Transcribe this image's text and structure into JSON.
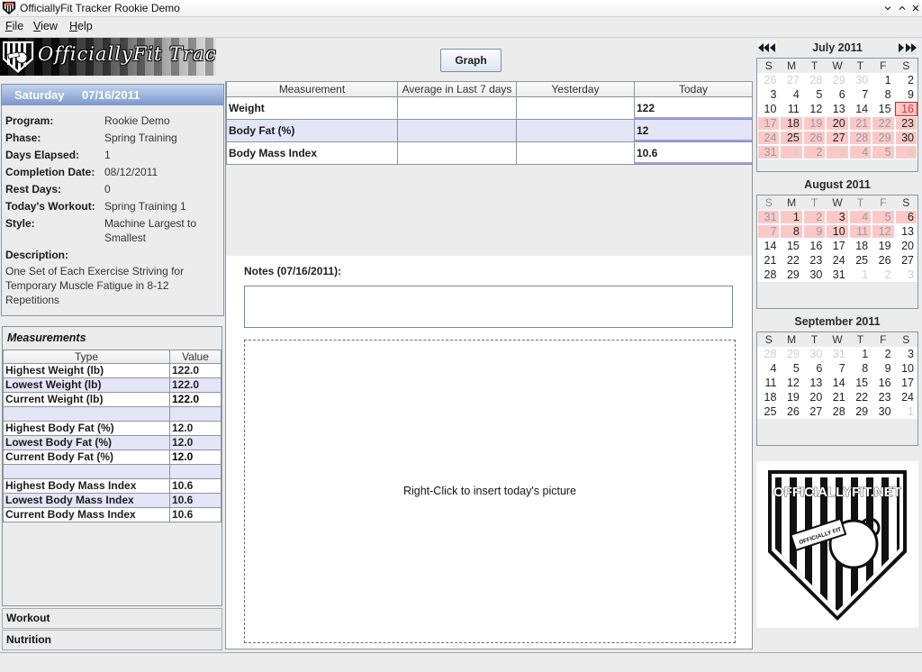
{
  "window": {
    "title": "OfficiallyFit Tracker Rookie Demo",
    "controls": [
      "minimize",
      "maximize",
      "close"
    ]
  },
  "menu": {
    "items": [
      {
        "label": "File"
      },
      {
        "label": "View"
      },
      {
        "label": "Help"
      }
    ]
  },
  "banner": {
    "text": "OfficiallyFit Tracker"
  },
  "day_header": {
    "weekday": "Saturday",
    "date": "07/16/2011"
  },
  "program_info": {
    "rows": [
      {
        "label": "Program:",
        "value": "Rookie Demo"
      },
      {
        "label": "Phase:",
        "value": "Spring Training"
      },
      {
        "label": "Days Elapsed:",
        "value": "1"
      },
      {
        "label": "Completion Date:",
        "value": "08/12/2011"
      },
      {
        "label": "Rest Days:",
        "value": "0"
      },
      {
        "label": "Today's Workout:",
        "value": "Spring Training 1"
      },
      {
        "label": "Style:",
        "value": "Machine Largest to Smallest"
      }
    ],
    "description_label": "Description:",
    "description": "One Set of Each Exercise Striving for Temporary Muscle Fatigue in 8-12 Repetitions"
  },
  "measurements": {
    "title": "Measurements",
    "columns": [
      "Type",
      "Value"
    ],
    "rows": [
      {
        "type": "Highest Weight (lb)",
        "value": "122.0"
      },
      {
        "type": "Lowest Weight (lb)",
        "value": "122.0"
      },
      {
        "type": "Current Weight (lb)",
        "value": "122.0"
      },
      {
        "type": "",
        "value": ""
      },
      {
        "type": "Highest Body Fat (%)",
        "value": "12.0"
      },
      {
        "type": "Lowest Body Fat (%)",
        "value": "12.0"
      },
      {
        "type": "Current Body Fat (%)",
        "value": "12.0"
      },
      {
        "type": "",
        "value": ""
      },
      {
        "type": "Highest Body Mass Index",
        "value": "10.6"
      },
      {
        "type": "Lowest Body Mass Index",
        "value": "10.6"
      },
      {
        "type": "Current Body Mass Index",
        "value": "10.6"
      }
    ]
  },
  "side_nav": {
    "workout": "Workout",
    "nutrition": "Nutrition"
  },
  "toolbar": {
    "graph_label": "Graph"
  },
  "daily_table": {
    "columns": [
      "Measurement",
      "Average in Last 7 days",
      "Yesterday",
      "Today"
    ],
    "rows": [
      {
        "measurement": "Weight",
        "average": "",
        "yesterday": "",
        "today": "122"
      },
      {
        "measurement": "Body Fat (%)",
        "average": "",
        "yesterday": "",
        "today": "12"
      },
      {
        "measurement": "Body Mass Index",
        "average": "",
        "yesterday": "",
        "today": "10.6"
      }
    ]
  },
  "notes": {
    "label": "Notes (07/16/2011):",
    "value": ""
  },
  "picture": {
    "hint": "Right-Click to insert today's picture"
  },
  "calendars": [
    {
      "title": "July 2011",
      "dow": [
        {
          "l": "S"
        },
        {
          "l": "M"
        },
        {
          "l": "T"
        },
        {
          "l": "W"
        },
        {
          "l": "T"
        },
        {
          "l": "F"
        },
        {
          "l": "S"
        }
      ],
      "weeks": [
        [
          {
            "d": "26",
            "tone": "faint"
          },
          {
            "d": "27",
            "tone": "faint"
          },
          {
            "d": "28",
            "tone": "faint"
          },
          {
            "d": "29",
            "tone": "faint"
          },
          {
            "d": "30",
            "tone": "faint"
          },
          {
            "d": "1"
          },
          {
            "d": "2"
          }
        ],
        [
          {
            "d": "3"
          },
          {
            "d": "4"
          },
          {
            "d": "5"
          },
          {
            "d": "6"
          },
          {
            "d": "7"
          },
          {
            "d": "8"
          },
          {
            "d": "9"
          }
        ],
        [
          {
            "d": "10"
          },
          {
            "d": "11"
          },
          {
            "d": "12"
          },
          {
            "d": "13"
          },
          {
            "d": "14"
          },
          {
            "d": "15"
          },
          {
            "d": "16",
            "sched": true,
            "today": true
          }
        ],
        [
          {
            "d": "17",
            "tone": "muted",
            "sched": true
          },
          {
            "d": "18",
            "sched": true
          },
          {
            "d": "19",
            "tone": "muted",
            "sched": true
          },
          {
            "d": "20",
            "sched": true
          },
          {
            "d": "21",
            "tone": "muted",
            "sched": true
          },
          {
            "d": "22",
            "tone": "muted",
            "sched": true
          },
          {
            "d": "23",
            "sched": true
          }
        ],
        [
          {
            "d": "24",
            "tone": "muted",
            "sched": true
          },
          {
            "d": "25",
            "sched": true
          },
          {
            "d": "26",
            "tone": "muted",
            "sched": true
          },
          {
            "d": "27",
            "sched": true
          },
          {
            "d": "28",
            "tone": "muted",
            "sched": true
          },
          {
            "d": "29",
            "tone": "muted",
            "sched": true
          },
          {
            "d": "30",
            "sched": true
          }
        ],
        [
          {
            "d": "31",
            "tone": "muted",
            "sched": true
          },
          {
            "d": "1",
            "tone": "faint",
            "sched": true
          },
          {
            "d": "2",
            "tone": "muted",
            "sched": true
          },
          {
            "d": "3",
            "tone": "faint",
            "sched": true
          },
          {
            "d": "4",
            "tone": "muted",
            "sched": true
          },
          {
            "d": "5",
            "tone": "muted",
            "sched": true
          },
          {
            "d": "6",
            "tone": "faint",
            "sched": true
          }
        ]
      ]
    },
    {
      "title": "August 2011",
      "dow": [
        {
          "l": "S",
          "muted": true
        },
        {
          "l": "M"
        },
        {
          "l": "T",
          "muted": true
        },
        {
          "l": "W"
        },
        {
          "l": "T",
          "muted": true
        },
        {
          "l": "F",
          "muted": true
        },
        {
          "l": "S"
        }
      ],
      "weeks": [
        [
          {
            "d": "31",
            "tone": "muted",
            "sched": true
          },
          {
            "d": "1",
            "sched": true
          },
          {
            "d": "2",
            "tone": "muted",
            "sched": true
          },
          {
            "d": "3",
            "sched": true
          },
          {
            "d": "4",
            "tone": "muted",
            "sched": true
          },
          {
            "d": "5",
            "tone": "muted",
            "sched": true
          },
          {
            "d": "6",
            "sched": true
          }
        ],
        [
          {
            "d": "7",
            "tone": "muted",
            "sched": true
          },
          {
            "d": "8",
            "sched": true
          },
          {
            "d": "9",
            "tone": "muted",
            "sched": true
          },
          {
            "d": "10",
            "sched": true
          },
          {
            "d": "11",
            "tone": "muted",
            "sched": true
          },
          {
            "d": "12",
            "tone": "muted",
            "sched": true
          },
          {
            "d": "13"
          }
        ],
        [
          {
            "d": "14"
          },
          {
            "d": "15"
          },
          {
            "d": "16"
          },
          {
            "d": "17"
          },
          {
            "d": "18"
          },
          {
            "d": "19"
          },
          {
            "d": "20"
          }
        ],
        [
          {
            "d": "21"
          },
          {
            "d": "22"
          },
          {
            "d": "23"
          },
          {
            "d": "24"
          },
          {
            "d": "25"
          },
          {
            "d": "26"
          },
          {
            "d": "27"
          }
        ],
        [
          {
            "d": "28"
          },
          {
            "d": "29"
          },
          {
            "d": "30"
          },
          {
            "d": "31"
          },
          {
            "d": "1",
            "tone": "faint"
          },
          {
            "d": "2",
            "tone": "faint"
          },
          {
            "d": "3",
            "tone": "faint"
          }
        ]
      ]
    },
    {
      "title": "September 2011",
      "dow": [
        {
          "l": "S"
        },
        {
          "l": "M"
        },
        {
          "l": "T"
        },
        {
          "l": "W"
        },
        {
          "l": "T"
        },
        {
          "l": "F"
        },
        {
          "l": "S"
        }
      ],
      "weeks": [
        [
          {
            "d": "28",
            "tone": "faint"
          },
          {
            "d": "29",
            "tone": "faint"
          },
          {
            "d": "30",
            "tone": "faint"
          },
          {
            "d": "31",
            "tone": "faint"
          },
          {
            "d": "1"
          },
          {
            "d": "2"
          },
          {
            "d": "3"
          }
        ],
        [
          {
            "d": "4"
          },
          {
            "d": "5"
          },
          {
            "d": "6"
          },
          {
            "d": "7"
          },
          {
            "d": "8"
          },
          {
            "d": "9"
          },
          {
            "d": "10"
          }
        ],
        [
          {
            "d": "11"
          },
          {
            "d": "12"
          },
          {
            "d": "13"
          },
          {
            "d": "14"
          },
          {
            "d": "15"
          },
          {
            "d": "16"
          },
          {
            "d": "17"
          }
        ],
        [
          {
            "d": "18"
          },
          {
            "d": "19"
          },
          {
            "d": "20"
          },
          {
            "d": "21"
          },
          {
            "d": "22"
          },
          {
            "d": "23"
          },
          {
            "d": "24"
          }
        ],
        [
          {
            "d": "25"
          },
          {
            "d": "26"
          },
          {
            "d": "27"
          },
          {
            "d": "28"
          },
          {
            "d": "29"
          },
          {
            "d": "30"
          },
          {
            "d": "1",
            "tone": "faint"
          }
        ]
      ]
    }
  ],
  "logo": {
    "text": "OFFICIALLYFIT.NET",
    "whistle_text": "OFFICIALLY FIT"
  },
  "colors": {
    "day_header_top": "#c3d3ec",
    "day_header_bottom": "#7a98cc",
    "scheduled_day": "#fbc8c8",
    "today_marker": "#e02020",
    "alt_row": "#e5e5f8",
    "today_cell_underline": "#9c9cee"
  }
}
